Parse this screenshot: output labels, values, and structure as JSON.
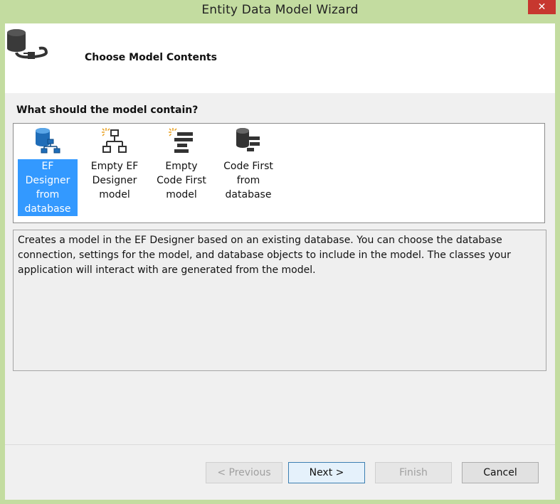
{
  "window": {
    "title": "Entity Data Model Wizard",
    "close_label": "✕"
  },
  "header": {
    "title": "Choose Model Contents",
    "icon": "database-plug-icon"
  },
  "question": "What should the model contain?",
  "items": [
    {
      "label": "EF Designer from database",
      "icon": "database-designer-icon",
      "selected": true
    },
    {
      "label": "Empty EF Designer model",
      "icon": "empty-designer-icon",
      "selected": false
    },
    {
      "label": "Empty Code First model",
      "icon": "empty-code-first-icon",
      "selected": false
    },
    {
      "label": "Code First from database",
      "icon": "code-first-database-icon",
      "selected": false
    }
  ],
  "description": "Creates a model in the EF Designer based on an existing database. You can choose the database connection, settings for the model, and database objects to include in the model. The classes your application will interact with are generated from the model.",
  "buttons": {
    "previous": "< Previous",
    "next": "Next >",
    "finish": "Finish",
    "cancel": "Cancel"
  },
  "colors": {
    "selection": "#3399ff",
    "titlebar": "#c3dca0",
    "close": "#c7372f"
  }
}
